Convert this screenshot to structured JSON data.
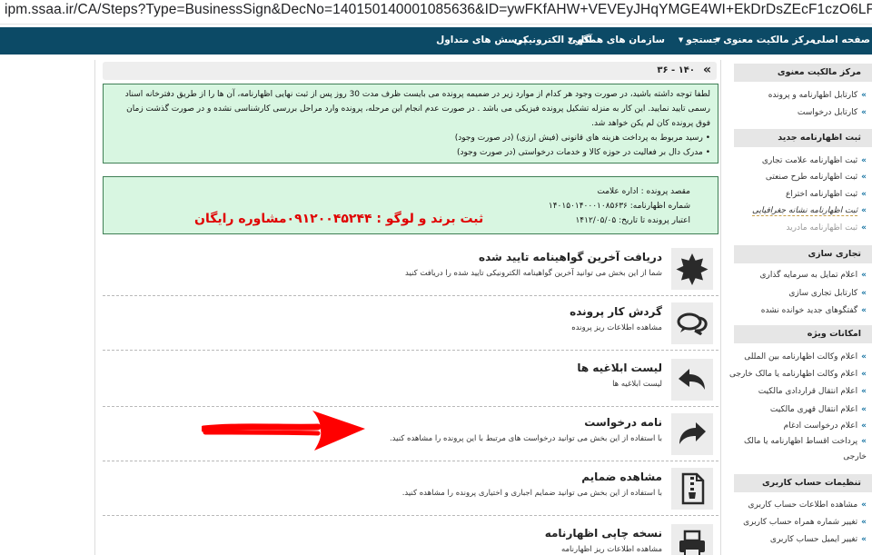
{
  "browser": {
    "url": "ipm.ssaa.ir/CA/Steps?Type=BusinessSign&DecNo=140150140001085636&ID=ywFKfAHW+VEVEyJHqYMGE4WI+EkDrDsZEcF1czO6LF8=#"
  },
  "topnav": {
    "items": [
      {
        "label": "صفحه اصلی",
        "caret": false
      },
      {
        "label": "مرکز مالکیت معنوی",
        "caret": true
      },
      {
        "label": "جستجو",
        "caret": true
      },
      {
        "label": "سازمان های همکار",
        "caret": true
      },
      {
        "label": "آگهی الکترونیکی",
        "caret": false
      },
      {
        "label": "پرسش های متداول",
        "caret": false
      }
    ]
  },
  "sidebar": {
    "sections": [
      {
        "header": "مرکز مالکیت معنوی",
        "items": [
          "کارتابل اظهارنامه و پرونده",
          "کارتابل درخواست"
        ]
      },
      {
        "header": "ثبت اظهارنامه جدید",
        "items": [
          "ثبت اظهارنامه علامت تجاری",
          "ثبت اظهارنامه طرح صنعتی",
          "ثبت اظهارنامه اختراع",
          "ثبت اظهارنامه نشانه جغرافیایی",
          "ثبت اظهارنامه مادرید"
        ]
      },
      {
        "header": "تجاری سازی",
        "items": [
          "اعلام تمایل به سرمایه گذاری",
          "کارتابل تجاری سازی",
          "گفتگوهای جدید خوانده نشده"
        ]
      },
      {
        "header": "امکانات ویژه",
        "items": [
          "اعلام وکالت اظهارنامه بین المللی",
          "اعلام وکالت اظهارنامه یا مالک خارجی",
          "اعلام انتقال قراردادی مالکیت",
          "اعلام انتقال قهری مالکیت",
          "اعلام درخواست ادغام",
          "پرداخت اقساط اظهارنامه یا مالک خارجی"
        ]
      },
      {
        "header": "تنظیمات حساب کاربری",
        "items": [
          "مشاهده اطلاعات حساب کاربری",
          "تغییر شماره همراه حساب کاربری",
          "تغییر ایمیل حساب کاربری"
        ]
      }
    ]
  },
  "main": {
    "crumb": "۱۴۰ -  ۳۶",
    "notice": {
      "intro": "لطفا توجه داشته باشید، در صورت وجود هر کدام از موارد زیر در ضمیمه پرونده می بایست ظرف مدت 30 روز پس از ثبت نهایی اظهارنامه، آن ها را از طریق دفترخانه اسناد رسمی تایید نمایید. این کار به منزله تشکیل پرونده فیزیکی می باشد . در صورت عدم انجام این مرحله، پرونده وارد مراحل بررسی کارشناسی نشده و در صورت گذشت زمان فوق پرونده کان لم یکن خواهد شد.",
      "bullets": [
        "رسید مربوط به پرداخت هزینه های قانونی (فیش ارزی) (در صورت وجود)",
        "مدرک دال بر فعالیت در حوزه کالا و خدمات درخواستی (در صورت وجود)"
      ]
    },
    "info": {
      "destination": "مقصد پرونده : اداره علامت",
      "decl_label": "شماره اظهارنامه:",
      "decl_value": "۱۴۰۱۵۰۱۴۰۰۰۱۰۸۵۶۳۶",
      "validity_label": "اعتبار پرونده تا تاریخ:",
      "validity_value": "۱۴۱۲/۰۵/۰۵",
      "promo": "ثبت برند و لوگو : ۰۹۱۲۰۰۴۵۲۴۴مشاوره رایگان"
    },
    "actions": [
      {
        "title": "دریافت آخرین گواهینامه تایید شده",
        "desc": "شما از این بخش می توانید آخرین گواهینامه الکترونیکی تایید شده را دریافت کنید",
        "icon": "badge-icon"
      },
      {
        "title": "گردش کار پرونده",
        "desc": "مشاهده اطلاعات ریز پرونده",
        "icon": "chat-bubbles-icon"
      },
      {
        "title": "لیست ابلاغیه ها",
        "desc": "لیست ابلاغیه ها",
        "icon": "reply-arrow-icon"
      },
      {
        "title": "نامه درخواست",
        "desc": "با استفاده از این بخش می توانید درخواست های مرتبط با این پرونده را مشاهده کنید.",
        "icon": "forward-arrow-icon"
      },
      {
        "title": "مشاهده ضمایم",
        "desc": "با استفاده از این بخش می توانید ضمایم اجباری و اختیاری پرونده را مشاهده کنید.",
        "icon": "zip-file-icon"
      },
      {
        "title": "نسخه چاپی اظهارنامه",
        "desc": "مشاهده اطلاعات ریز اظهارنامه",
        "icon": "printer-icon"
      }
    ]
  },
  "colors": {
    "nav_bg": "#0c4a66",
    "notice_bg": "#d8f6e1",
    "promo_red": "#e00000",
    "annotation_arrow": "#ff0000"
  }
}
